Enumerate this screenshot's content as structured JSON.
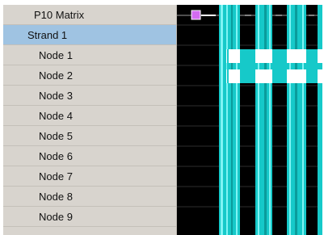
{
  "tree": {
    "matrix_label": "P10 Matrix",
    "strand_label": "Strand 1",
    "nodes": [
      {
        "label": "Node 1"
      },
      {
        "label": "Node 2"
      },
      {
        "label": "Node 3"
      },
      {
        "label": "Node 4"
      },
      {
        "label": "Node 5"
      },
      {
        "label": "Node 6"
      },
      {
        "label": "Node 7"
      },
      {
        "label": "Node 8"
      },
      {
        "label": "Node 9"
      }
    ]
  },
  "timeline": {
    "colors": {
      "background": "#000000",
      "effect": "#21d6d6",
      "effect_light": "#6ff0f0",
      "marker": "#d36cf0",
      "grid": "#3a3a3a"
    },
    "icons": [
      "playhead-marker-icon"
    ]
  }
}
